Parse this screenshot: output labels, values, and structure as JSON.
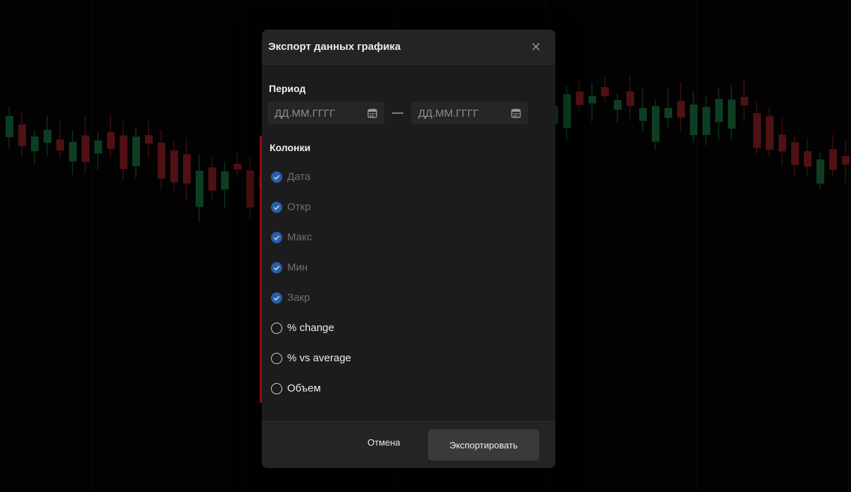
{
  "dialog": {
    "title": "Экспорт данных графика",
    "close_icon": "close-icon"
  },
  "period": {
    "label": "Период",
    "from_placeholder": "ДД.ММ.ГГГГ",
    "to_placeholder": "ДД.ММ.ГГГГ",
    "separator": "—",
    "calendar_icon": "calendar-icon"
  },
  "columns": {
    "label": "Колонки",
    "items": [
      {
        "label": "Дата",
        "checked": true,
        "disabled": true
      },
      {
        "label": "Откр",
        "checked": true,
        "disabled": true
      },
      {
        "label": "Макс",
        "checked": true,
        "disabled": true
      },
      {
        "label": "Мин",
        "checked": true,
        "disabled": true
      },
      {
        "label": "Закр",
        "checked": true,
        "disabled": true
      },
      {
        "label": "% change",
        "checked": false,
        "disabled": false
      },
      {
        "label": "% vs average",
        "checked": false,
        "disabled": false
      },
      {
        "label": "Объем",
        "checked": false,
        "disabled": false
      }
    ]
  },
  "footer": {
    "cancel_label": "Отмена",
    "export_label": "Экспортировать"
  },
  "colors": {
    "accent": "#2b77d6",
    "highlight": "#e0141e",
    "candle_up": "#1f8a4c",
    "candle_down": "#b0262c"
  }
}
